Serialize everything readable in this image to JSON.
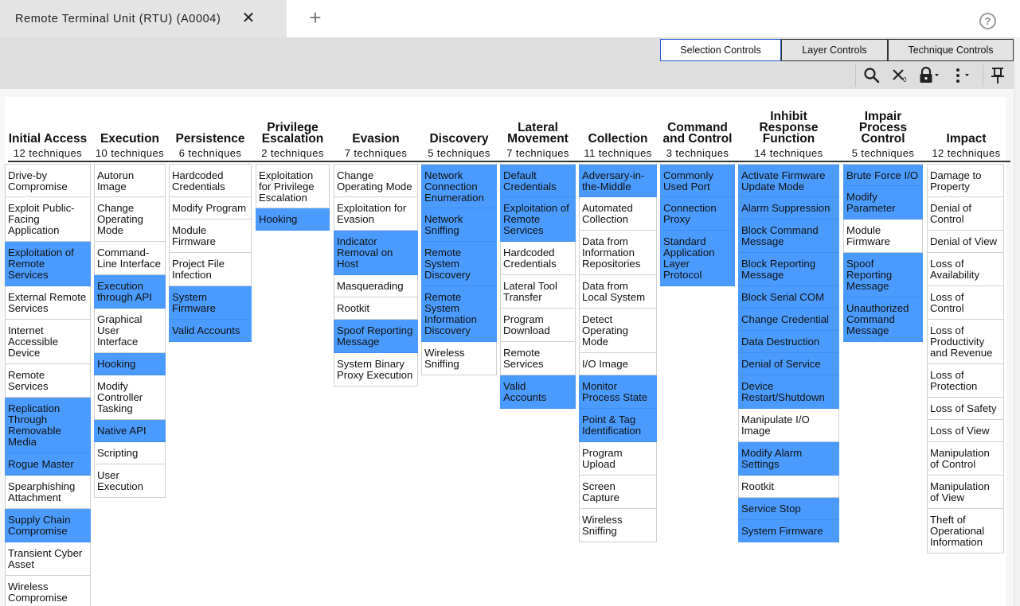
{
  "tab": {
    "title": "Remote Terminal Unit (RTU) (A0004)",
    "close": "✕",
    "new_tab": "+"
  },
  "help": "?",
  "controls": [
    "Selection Controls",
    "Layer Controls",
    "Technique Controls"
  ],
  "toolbar": {
    "search_icon": "search-icon",
    "clear_icon": "clear-selection-icon",
    "clear_count": "0",
    "lock_icon": "lock-icon",
    "more_icon": "more-options-icon",
    "pin_icon": "pin-icon"
  },
  "colors": {
    "highlight": "#4b9bff",
    "active_control_border": "#2a5ad6"
  },
  "tactics": [
    {
      "name": [
        "Initial Access"
      ],
      "count": "12 techniques",
      "techniques": [
        {
          "label": [
            "Drive-by",
            "Compromise"
          ],
          "hl": false
        },
        {
          "label": [
            "Exploit Public-",
            "Facing",
            "Application"
          ],
          "hl": false
        },
        {
          "label": [
            "Exploitation of",
            "Remote",
            "Services"
          ],
          "hl": true
        },
        {
          "label": [
            "External Remote",
            "Services"
          ],
          "hl": false
        },
        {
          "label": [
            "Internet",
            "Accessible",
            "Device"
          ],
          "hl": false
        },
        {
          "label": [
            "Remote",
            "Services"
          ],
          "hl": false
        },
        {
          "label": [
            "Replication",
            "Through",
            "Removable",
            "Media"
          ],
          "hl": true
        },
        {
          "label": [
            "Rogue Master"
          ],
          "hl": true
        },
        {
          "label": [
            "Spearphishing",
            "Attachment"
          ],
          "hl": false
        },
        {
          "label": [
            "Supply Chain",
            "Compromise"
          ],
          "hl": true
        },
        {
          "label": [
            "Transient Cyber",
            "Asset"
          ],
          "hl": false
        },
        {
          "label": [
            "Wireless",
            "Compromise"
          ],
          "hl": false
        }
      ]
    },
    {
      "name": [
        "Execution"
      ],
      "count": "10 techniques",
      "techniques": [
        {
          "label": [
            "Autorun",
            "Image"
          ],
          "hl": false
        },
        {
          "label": [
            "Change",
            "Operating",
            "Mode"
          ],
          "hl": false
        },
        {
          "label": [
            "Command-",
            "Line Interface"
          ],
          "hl": false
        },
        {
          "label": [
            "Execution",
            "through API"
          ],
          "hl": true
        },
        {
          "label": [
            "Graphical",
            "User",
            "Interface"
          ],
          "hl": false
        },
        {
          "label": [
            "Hooking"
          ],
          "hl": true
        },
        {
          "label": [
            "Modify",
            "Controller",
            "Tasking"
          ],
          "hl": false
        },
        {
          "label": [
            "Native API"
          ],
          "hl": true
        },
        {
          "label": [
            "Scripting"
          ],
          "hl": false
        },
        {
          "label": [
            "User",
            "Execution"
          ],
          "hl": false
        }
      ]
    },
    {
      "name": [
        "Persistence"
      ],
      "count": "6 techniques",
      "techniques": [
        {
          "label": [
            "Hardcoded",
            "Credentials"
          ],
          "hl": false
        },
        {
          "label": [
            "Modify Program"
          ],
          "hl": false
        },
        {
          "label": [
            "Module",
            "Firmware"
          ],
          "hl": false
        },
        {
          "label": [
            "Project File",
            "Infection"
          ],
          "hl": false
        },
        {
          "label": [
            "System",
            "Firmware"
          ],
          "hl": true
        },
        {
          "label": [
            "Valid Accounts"
          ],
          "hl": true
        }
      ]
    },
    {
      "name": [
        "Privilege",
        "Escalation"
      ],
      "count": "2 techniques",
      "techniques": [
        {
          "label": [
            "Exploitation",
            "for Privilege",
            "Escalation"
          ],
          "hl": false
        },
        {
          "label": [
            "Hooking"
          ],
          "hl": true
        }
      ]
    },
    {
      "name": [
        "Evasion"
      ],
      "count": "7 techniques",
      "techniques": [
        {
          "label": [
            "Change",
            "Operating Mode"
          ],
          "hl": false
        },
        {
          "label": [
            "Exploitation for",
            "Evasion"
          ],
          "hl": false
        },
        {
          "label": [
            "Indicator",
            "Removal on",
            "Host"
          ],
          "hl": true
        },
        {
          "label": [
            "Masquerading"
          ],
          "hl": false
        },
        {
          "label": [
            "Rootkit"
          ],
          "hl": false
        },
        {
          "label": [
            "Spoof Reporting",
            "Message"
          ],
          "hl": true
        },
        {
          "label": [
            "System Binary",
            "Proxy Execution"
          ],
          "hl": false
        }
      ]
    },
    {
      "name": [
        "Discovery"
      ],
      "count": "5 techniques",
      "techniques": [
        {
          "label": [
            "Network",
            "Connection",
            "Enumeration"
          ],
          "hl": true
        },
        {
          "label": [
            "Network",
            "Sniffing"
          ],
          "hl": true
        },
        {
          "label": [
            "Remote",
            "System",
            "Discovery"
          ],
          "hl": true
        },
        {
          "label": [
            "Remote",
            "System",
            "Information",
            "Discovery"
          ],
          "hl": true
        },
        {
          "label": [
            "Wireless",
            "Sniffing"
          ],
          "hl": false
        }
      ]
    },
    {
      "name": [
        "Lateral",
        "Movement"
      ],
      "count": "7 techniques",
      "techniques": [
        {
          "label": [
            "Default",
            "Credentials"
          ],
          "hl": true
        },
        {
          "label": [
            "Exploitation of",
            "Remote",
            "Services"
          ],
          "hl": true
        },
        {
          "label": [
            "Hardcoded",
            "Credentials"
          ],
          "hl": false
        },
        {
          "label": [
            "Lateral Tool",
            "Transfer"
          ],
          "hl": false
        },
        {
          "label": [
            "Program",
            "Download"
          ],
          "hl": false
        },
        {
          "label": [
            "Remote",
            "Services"
          ],
          "hl": false
        },
        {
          "label": [
            "Valid",
            "Accounts"
          ],
          "hl": true
        }
      ]
    },
    {
      "name": [
        "Collection"
      ],
      "count": "11 techniques",
      "techniques": [
        {
          "label": [
            "Adversary-in-",
            "the-Middle"
          ],
          "hl": true
        },
        {
          "label": [
            "Automated",
            "Collection"
          ],
          "hl": false
        },
        {
          "label": [
            "Data from",
            "Information",
            "Repositories"
          ],
          "hl": false
        },
        {
          "label": [
            "Data from",
            "Local System"
          ],
          "hl": false
        },
        {
          "label": [
            "Detect",
            "Operating",
            "Mode"
          ],
          "hl": false
        },
        {
          "label": [
            "I/O Image"
          ],
          "hl": false
        },
        {
          "label": [
            "Monitor",
            "Process State"
          ],
          "hl": true
        },
        {
          "label": [
            "Point & Tag",
            "Identification"
          ],
          "hl": true
        },
        {
          "label": [
            "Program",
            "Upload"
          ],
          "hl": false
        },
        {
          "label": [
            "Screen",
            "Capture"
          ],
          "hl": false
        },
        {
          "label": [
            "Wireless",
            "Sniffing"
          ],
          "hl": false
        }
      ]
    },
    {
      "name": [
        "Command",
        "and Control"
      ],
      "count": "3 techniques",
      "techniques": [
        {
          "label": [
            "Commonly",
            "Used Port"
          ],
          "hl": true
        },
        {
          "label": [
            "Connection",
            "Proxy"
          ],
          "hl": true
        },
        {
          "label": [
            "Standard",
            "Application",
            "Layer",
            "Protocol"
          ],
          "hl": true
        }
      ]
    },
    {
      "name": [
        "Inhibit",
        "Response",
        "Function"
      ],
      "count": "14 techniques",
      "techniques": [
        {
          "label": [
            "Activate Firmware",
            "Update Mode"
          ],
          "hl": true
        },
        {
          "label": [
            "Alarm Suppression"
          ],
          "hl": true
        },
        {
          "label": [
            "Block Command",
            "Message"
          ],
          "hl": true
        },
        {
          "label": [
            "Block Reporting",
            "Message"
          ],
          "hl": true
        },
        {
          "label": [
            "Block Serial COM"
          ],
          "hl": true
        },
        {
          "label": [
            "Change Credential"
          ],
          "hl": true
        },
        {
          "label": [
            "Data Destruction"
          ],
          "hl": true
        },
        {
          "label": [
            "Denial of Service"
          ],
          "hl": true
        },
        {
          "label": [
            "Device",
            "Restart/Shutdown"
          ],
          "hl": true
        },
        {
          "label": [
            "Manipulate I/O",
            "Image"
          ],
          "hl": false
        },
        {
          "label": [
            "Modify Alarm",
            "Settings"
          ],
          "hl": true
        },
        {
          "label": [
            "Rootkit"
          ],
          "hl": false
        },
        {
          "label": [
            "Service Stop"
          ],
          "hl": true
        },
        {
          "label": [
            "System Firmware"
          ],
          "hl": true
        }
      ]
    },
    {
      "name": [
        "Impair",
        "Process",
        "Control"
      ],
      "count": "5 techniques",
      "techniques": [
        {
          "label": [
            "Brute Force I/O"
          ],
          "hl": true
        },
        {
          "label": [
            "Modify",
            "Parameter"
          ],
          "hl": true
        },
        {
          "label": [
            "Module",
            "Firmware"
          ],
          "hl": false
        },
        {
          "label": [
            "Spoof",
            "Reporting",
            "Message"
          ],
          "hl": true
        },
        {
          "label": [
            "Unauthorized",
            "Command",
            "Message"
          ],
          "hl": true
        }
      ]
    },
    {
      "name": [
        "Impact"
      ],
      "count": "12 techniques",
      "techniques": [
        {
          "label": [
            "Damage to",
            "Property"
          ],
          "hl": false
        },
        {
          "label": [
            "Denial of",
            "Control"
          ],
          "hl": false
        },
        {
          "label": [
            "Denial of View"
          ],
          "hl": false
        },
        {
          "label": [
            "Loss of",
            "Availability"
          ],
          "hl": false
        },
        {
          "label": [
            "Loss of",
            "Control"
          ],
          "hl": false
        },
        {
          "label": [
            "Loss of",
            "Productivity",
            "and Revenue"
          ],
          "hl": false
        },
        {
          "label": [
            "Loss of",
            "Protection"
          ],
          "hl": false
        },
        {
          "label": [
            "Loss of Safety"
          ],
          "hl": false
        },
        {
          "label": [
            "Loss of View"
          ],
          "hl": false
        },
        {
          "label": [
            "Manipulation",
            "of Control"
          ],
          "hl": false
        },
        {
          "label": [
            "Manipulation",
            "of View"
          ],
          "hl": false
        },
        {
          "label": [
            "Theft of",
            "Operational",
            "Information"
          ],
          "hl": false
        }
      ]
    }
  ]
}
